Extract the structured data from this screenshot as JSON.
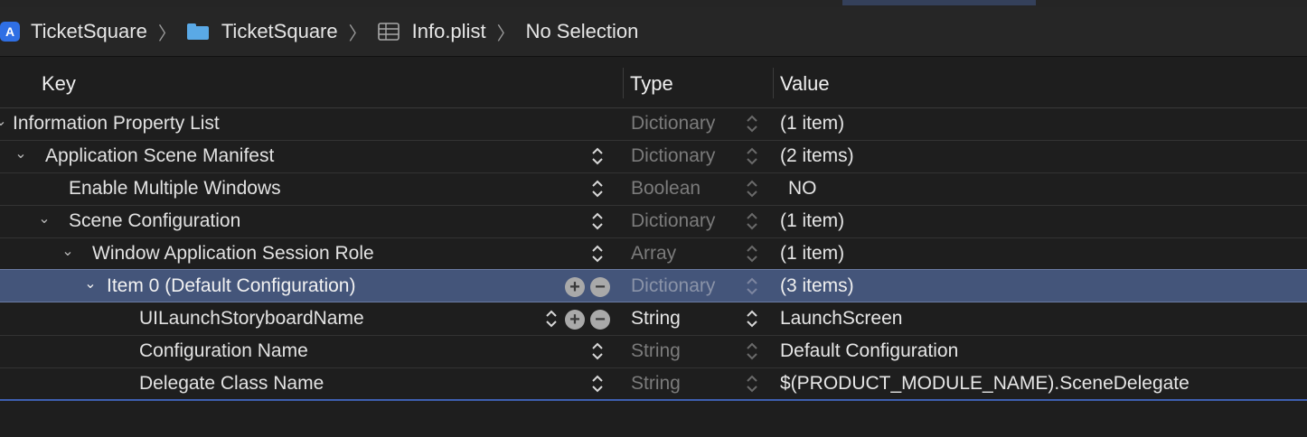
{
  "breadcrumb": {
    "items": [
      {
        "label": "TicketSquare",
        "icon": "app-icon"
      },
      {
        "label": "TicketSquare",
        "icon": "folder-icon"
      },
      {
        "label": "Info.plist",
        "icon": "plist-table-icon"
      },
      {
        "label": "No Selection",
        "icon": ""
      }
    ],
    "separator": "〉"
  },
  "columns": {
    "key": "Key",
    "type": "Type",
    "value": "Value"
  },
  "rows": [
    {
      "key": "Information Property List",
      "type": "Dictionary",
      "value": "(1 item)"
    },
    {
      "key": "Application Scene Manifest",
      "type": "Dictionary",
      "value": "(2 items)"
    },
    {
      "key": "Enable Multiple Windows",
      "type": "Boolean",
      "value": "NO"
    },
    {
      "key": "Scene Configuration",
      "type": "Dictionary",
      "value": "(1 item)"
    },
    {
      "key": "Window Application Session Role",
      "type": "Array",
      "value": "(1 item)"
    },
    {
      "key": "Item 0 (Default Configuration)",
      "type": "Dictionary",
      "value": "(3 items)"
    },
    {
      "key": "UILaunchStoryboardName",
      "type": "String",
      "value": "LaunchScreen"
    },
    {
      "key": "Configuration Name",
      "type": "String",
      "value": "Default Configuration"
    },
    {
      "key": "Delegate Class Name",
      "type": "String",
      "value": "$(PRODUCT_MODULE_NAME).SceneDelegate"
    }
  ],
  "buttons": {
    "add": "+",
    "remove": "−"
  },
  "colors": {
    "selection": "#44557a",
    "accent": "#3e5fb0",
    "folder": "#5aa9e6",
    "app": "#2f6fe4"
  }
}
